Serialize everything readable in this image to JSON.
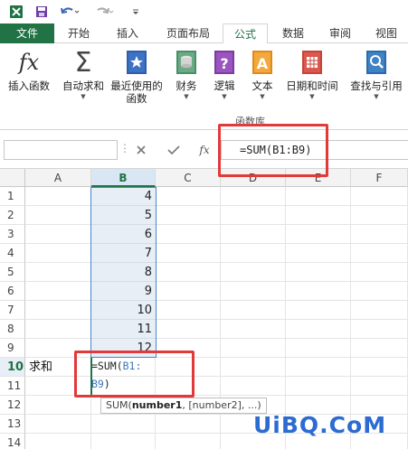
{
  "tabs": [
    {
      "label": "文件"
    },
    {
      "label": "开始"
    },
    {
      "label": "插入"
    },
    {
      "label": "页面布局"
    },
    {
      "label": "公式"
    },
    {
      "label": "数据"
    },
    {
      "label": "审阅"
    },
    {
      "label": "视图"
    }
  ],
  "ribbon": {
    "buttons": [
      {
        "label": "插入函数",
        "icon": "fx-icon"
      },
      {
        "label": "自动求和",
        "icon": "sigma-icon"
      },
      {
        "label": "最近使用的",
        "sub": "函数",
        "icon": "star-book-icon"
      },
      {
        "label": "财务",
        "icon": "coins-book-icon"
      },
      {
        "label": "逻辑",
        "icon": "question-book-icon"
      },
      {
        "label": "文本",
        "icon": "text-a-book-icon"
      },
      {
        "label": "日期和时间",
        "icon": "calendar-book-icon"
      },
      {
        "label": "查找与引用",
        "icon": "magnifier-book-icon"
      }
    ],
    "group_label": "函数库",
    "fx_glyph": "fx",
    "sigma_glyph": "Σ"
  },
  "formula_bar": {
    "formula": "=SUM(B1:B9)",
    "fx_label": "fx"
  },
  "columns": [
    "A",
    "B",
    "C",
    "D",
    "E",
    "F"
  ],
  "rows": [
    "1",
    "2",
    "3",
    "4",
    "5",
    "6",
    "7",
    "8",
    "9",
    "10",
    "11",
    "12",
    "13",
    "14"
  ],
  "column_b_values": [
    "4",
    "5",
    "6",
    "7",
    "8",
    "9",
    "10",
    "11",
    "12"
  ],
  "edit": {
    "row_label": "求和",
    "prefix": "=SUM(",
    "ref1": "B1:",
    "ref2": "B9",
    "suffix": ")"
  },
  "tooltip": {
    "fn": "SUM(",
    "arg1": "number1",
    "rest": ", [number2], ...)"
  },
  "watermark": "UiBQ.CoM",
  "colors": {
    "excel_green": "#217346",
    "highlight_red": "#e13a3a",
    "selection_blue": "#3c77bd",
    "watermark_blue": "#2c6bd1"
  }
}
